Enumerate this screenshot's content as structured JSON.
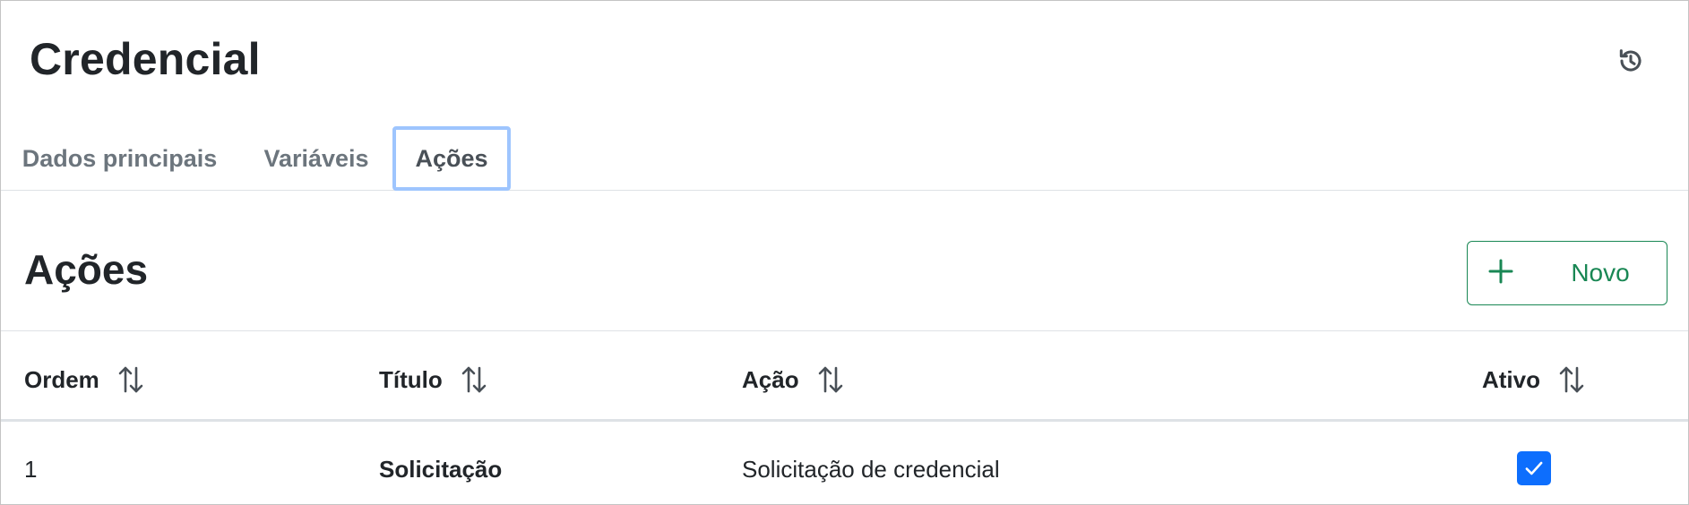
{
  "page": {
    "title": "Credencial"
  },
  "header": {
    "history_icon": "history-icon"
  },
  "tabs": [
    {
      "label": "Dados principais",
      "active": false
    },
    {
      "label": "Variáveis",
      "active": false
    },
    {
      "label": "Ações",
      "active": true
    }
  ],
  "section": {
    "title": "Ações",
    "new_button": {
      "label": "Novo",
      "icon": "plus-icon"
    }
  },
  "table": {
    "columns": [
      {
        "label": "Ordem",
        "sort_icon": "sort-icon"
      },
      {
        "label": "Título",
        "sort_icon": "sort-icon"
      },
      {
        "label": "Ação",
        "sort_icon": "sort-icon"
      },
      {
        "label": "Ativo",
        "sort_icon": "sort-icon"
      }
    ],
    "rows": [
      {
        "ordem": "1",
        "titulo": "Solicitação",
        "acao": "Solicitação de credencial",
        "ativo": true
      }
    ]
  },
  "colors": {
    "primary": "#0d6efd",
    "success": "#198754",
    "tab_focus": "#9ec5fe",
    "muted": "#6c757d",
    "text": "#212529"
  }
}
